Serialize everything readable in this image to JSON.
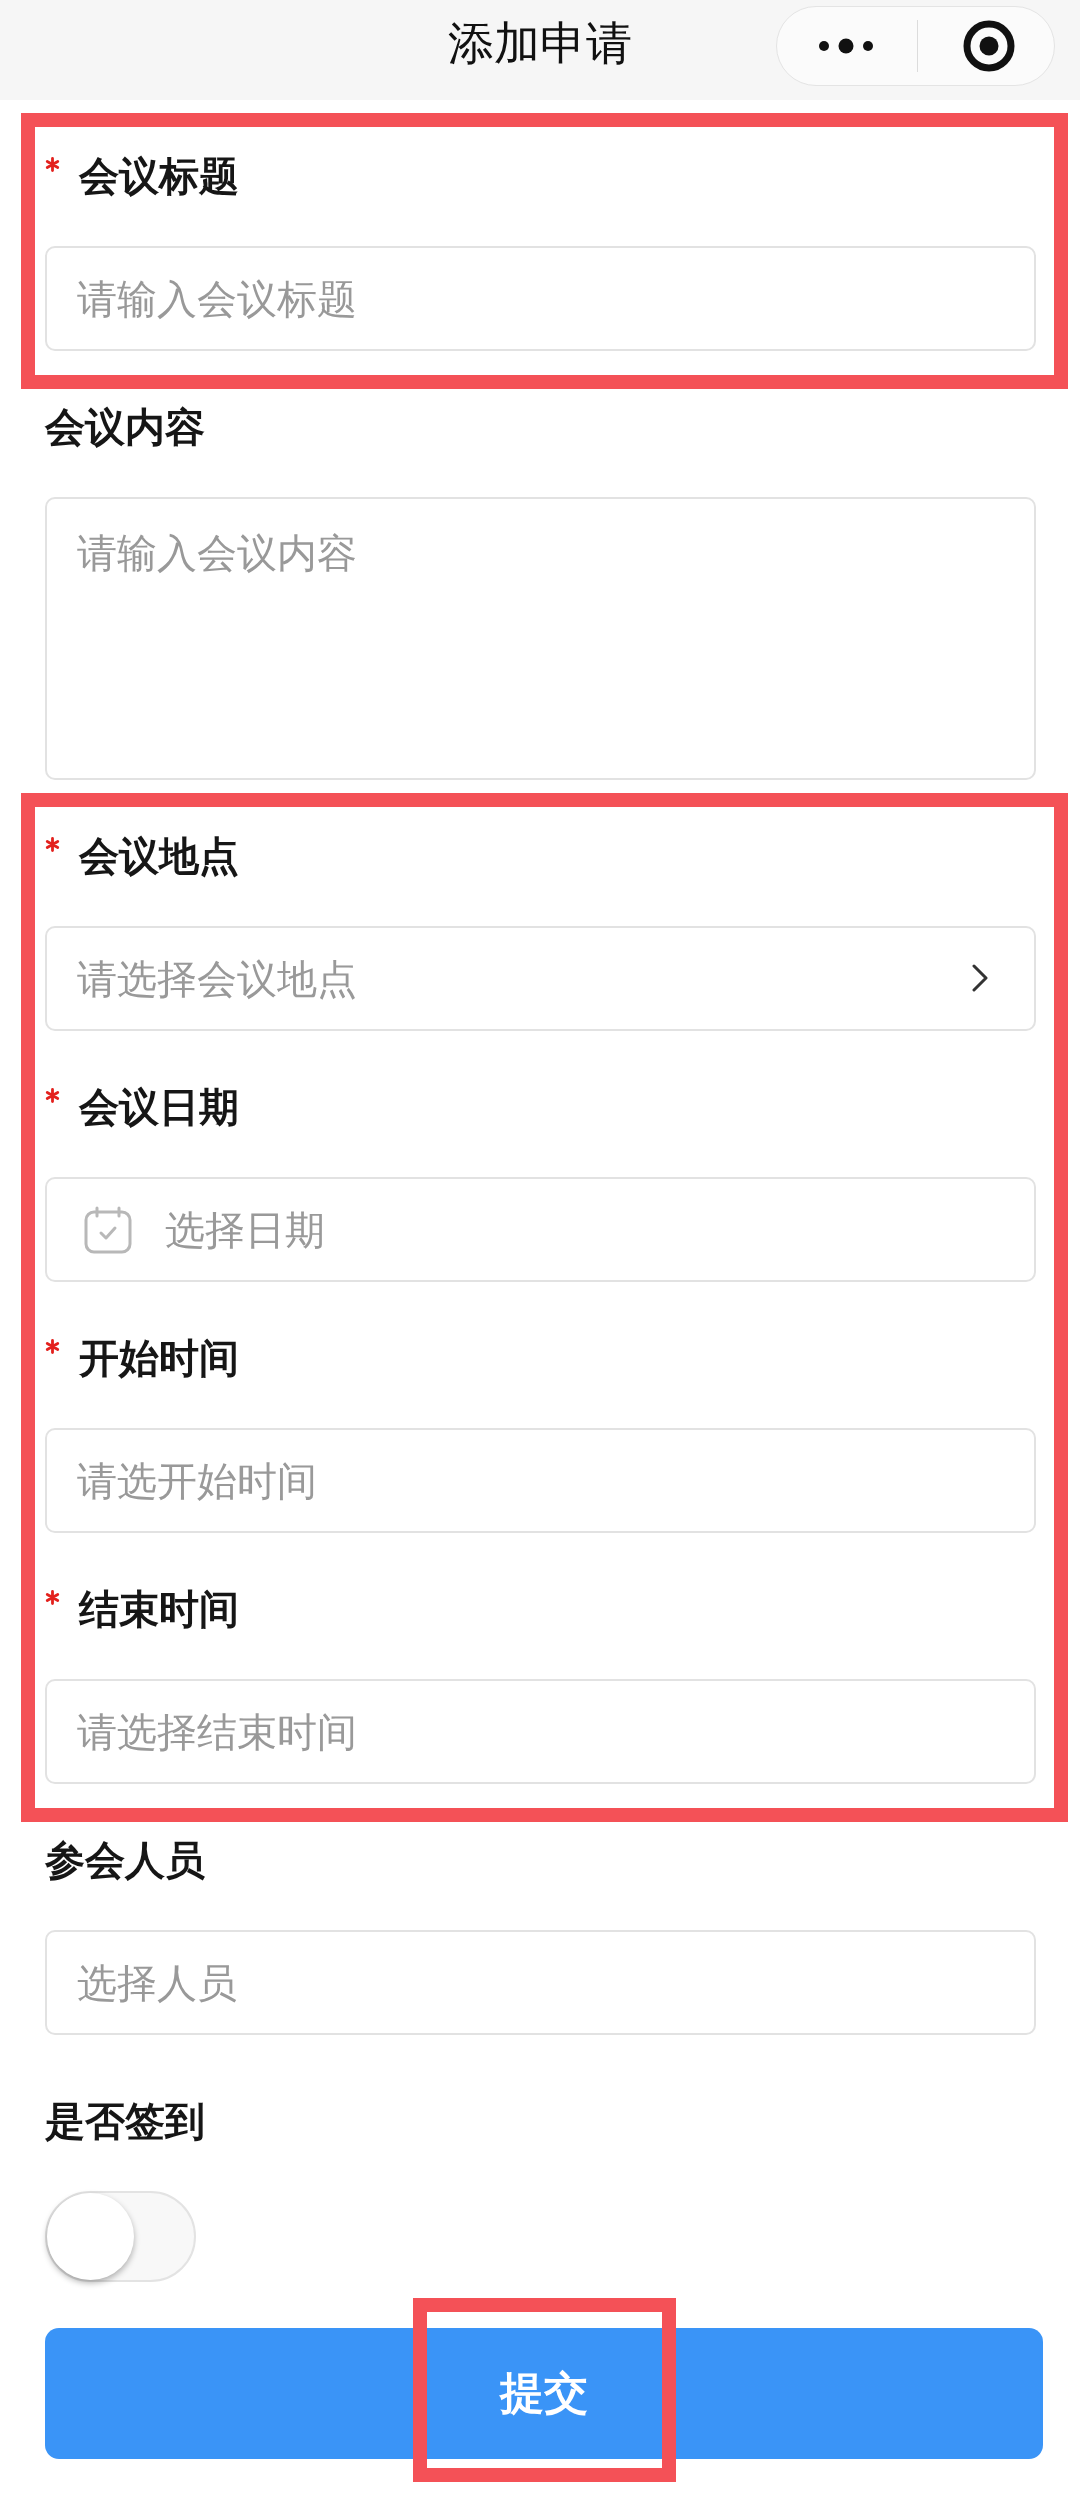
{
  "nav_bar": {
    "title": "添加申请"
  },
  "sections": [
    {
      "highlighted": true,
      "fields": [
        {
          "kind": "text",
          "label": "会议标题",
          "required": true,
          "placeholder": "请输入会议标题"
        }
      ]
    },
    {
      "highlighted": false,
      "fields": [
        {
          "kind": "textarea",
          "label": "会议内容",
          "required": false,
          "placeholder": "请输入会议内容"
        }
      ]
    },
    {
      "highlighted": true,
      "fields": [
        {
          "kind": "picker",
          "label": "会议地点",
          "required": true,
          "placeholder": "请选择会议地点"
        },
        {
          "kind": "date",
          "label": "会议日期",
          "required": true,
          "placeholder": "选择日期"
        },
        {
          "kind": "text",
          "label": "开始时间",
          "required": true,
          "placeholder": "请选开始时间"
        },
        {
          "kind": "text",
          "label": "结束时间",
          "required": true,
          "placeholder": "请选择结束时间"
        }
      ]
    },
    {
      "highlighted": false,
      "fields": [
        {
          "kind": "text",
          "label": "参会人员",
          "required": false,
          "placeholder": "选择人员"
        },
        {
          "kind": "switch",
          "label": "是否签到",
          "required": false,
          "on": false
        }
      ]
    }
  ],
  "submit_button": {
    "label": "提交",
    "highlighted": true
  }
}
